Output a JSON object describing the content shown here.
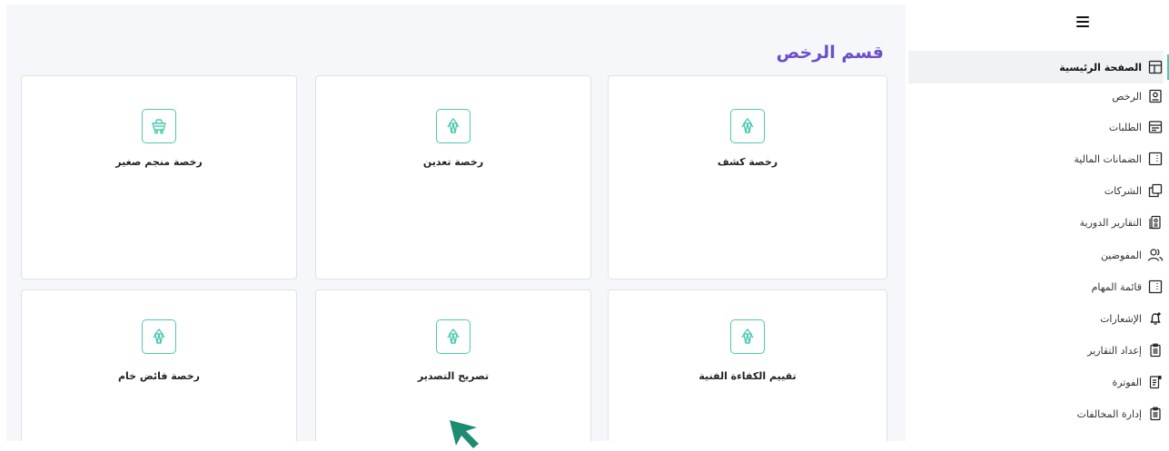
{
  "main": {
    "title": "قسم الرخص",
    "cards": [
      {
        "label": "رخصة كشف",
        "icon": "gem-icon"
      },
      {
        "label": "رخصة تعدين",
        "icon": "gem-icon"
      },
      {
        "label": "رخصة منجم صغير",
        "icon": "mine-cart-icon"
      },
      {
        "label": "تقييم الكفاءة الفنية",
        "icon": "gem-icon"
      },
      {
        "label": "تصريح التصدير",
        "icon": "gem-icon"
      },
      {
        "label": "رخصة فائض خام",
        "icon": "gem-icon"
      }
    ]
  },
  "sidebar": {
    "items": [
      {
        "label": "الصفحة الرئيسية",
        "icon": "layout-icon",
        "active": true
      },
      {
        "label": "الرخص",
        "icon": "license-icon"
      },
      {
        "label": "الطلبات",
        "icon": "requests-icon"
      },
      {
        "label": "الضمانات المالية",
        "icon": "guarantees-icon"
      },
      {
        "label": "الشركات",
        "icon": "companies-icon"
      },
      {
        "label": "التقارير الدورية",
        "icon": "reports-icon"
      },
      {
        "label": "المفوضين",
        "icon": "users-icon"
      },
      {
        "label": "قائمة المهام",
        "icon": "tasks-icon"
      },
      {
        "label": "الإشعارات",
        "icon": "bell-icon"
      },
      {
        "label": "إعداد التقارير",
        "icon": "clipboard-icon"
      },
      {
        "label": "الفوترة",
        "icon": "invoice-icon"
      },
      {
        "label": "إدارة المخالفات",
        "icon": "clipboard-icon"
      }
    ]
  },
  "colors": {
    "accent": "#4cc9b0",
    "title": "#6a4fc8",
    "cursor": "#1e8c72"
  }
}
